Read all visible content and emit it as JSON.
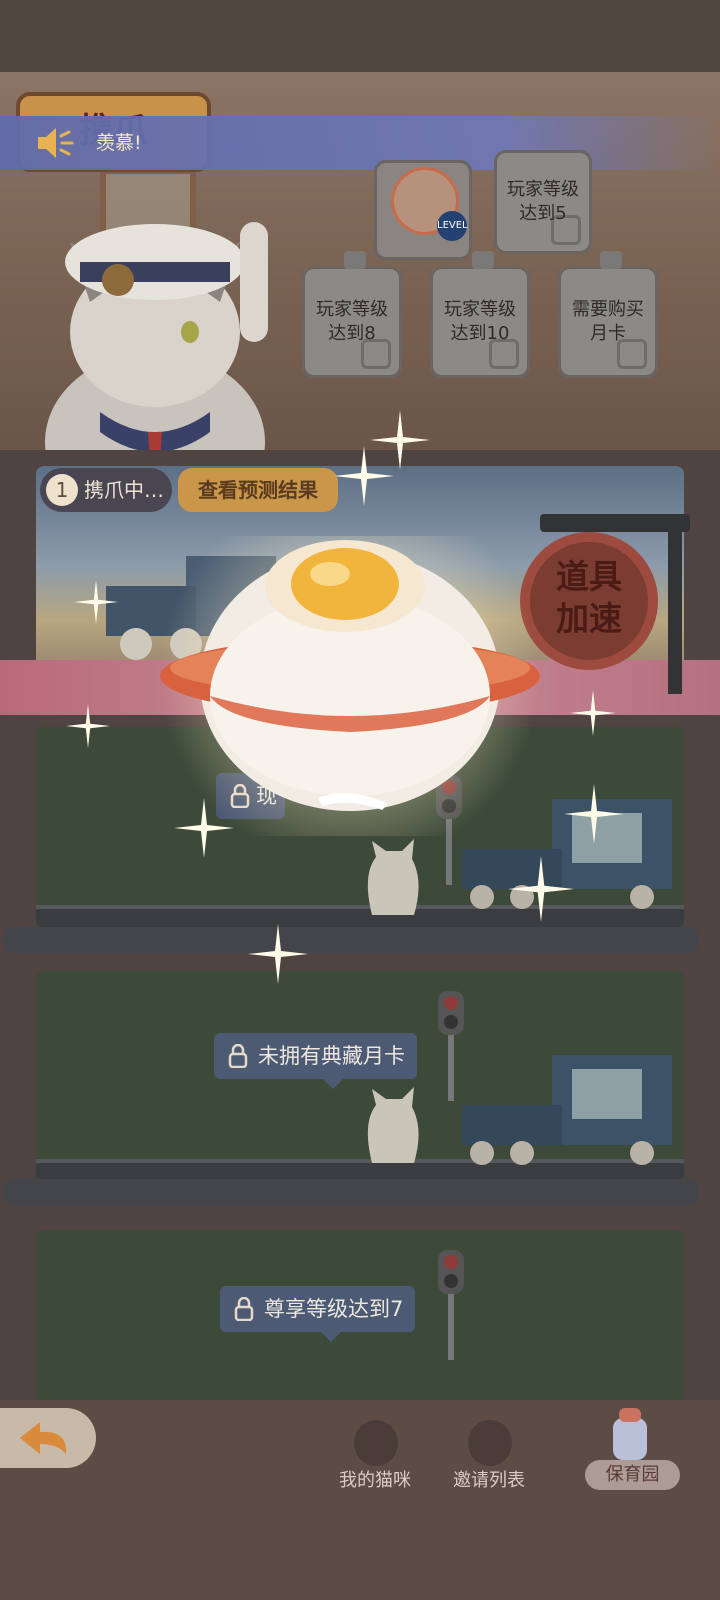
{
  "hero": {
    "tab_title": "携爪",
    "announcement": "羡慕!",
    "slots": [
      {
        "label": "玩家等级\n达到5"
      },
      {
        "label": "玩家等级\n达到8"
      },
      {
        "label": "玩家等级\n达到10"
      },
      {
        "label": "需要购买\n月卡"
      }
    ],
    "cat_badge": "LEVEL"
  },
  "lane1": {
    "status_num": "1",
    "status_text": "携爪中…",
    "predict_label": "查看预测结果",
    "boost_label_1": "道具",
    "boost_label_2": "加速"
  },
  "lane2": {
    "lock_text": "现"
  },
  "lane3": {
    "lock_text": "未拥有典藏月卡"
  },
  "lane4": {
    "lock_text": "尊享等级达到7"
  },
  "nav": {
    "my_cats": "我的猫咪",
    "invite_list": "邀请列表",
    "kindergarten": "保育园"
  },
  "icons": {
    "announce": "speaker-icon",
    "back": "back-arrow-icon",
    "lock": "lock-icon"
  },
  "colors": {
    "accent_orange": "#c9964a",
    "announce_bar": "#606baa",
    "lock_pill": "#4d5a74"
  }
}
